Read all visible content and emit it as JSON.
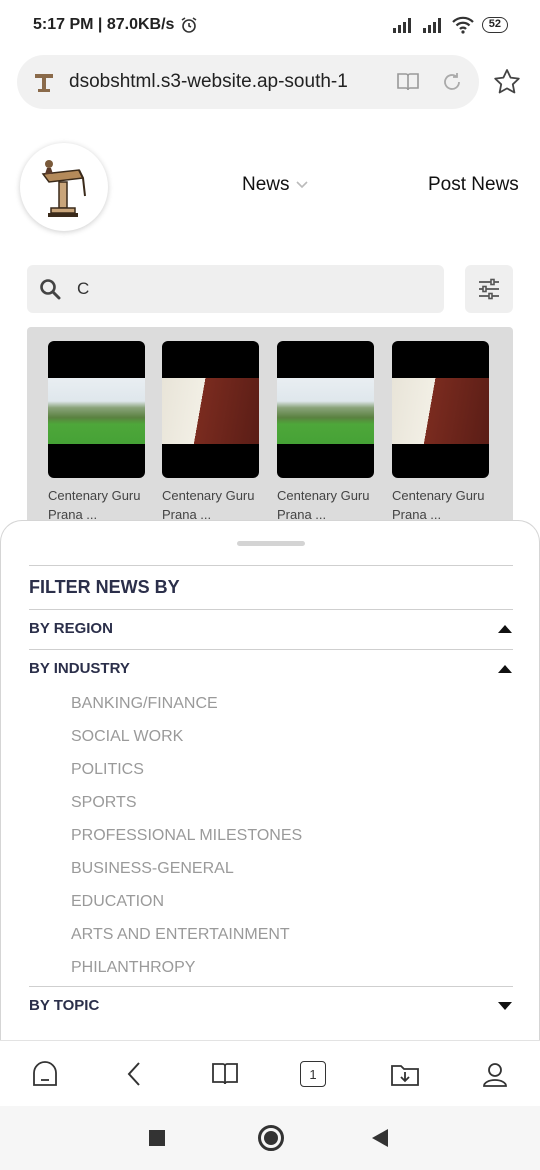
{
  "status_bar": {
    "time_speed": "5:17 PM | 87.0KB/s",
    "battery": "52"
  },
  "browser": {
    "url": "dsobshtml.s3-website.ap-south-1",
    "tab_count": "1"
  },
  "header": {
    "nav_news": "News",
    "nav_post": "Post News"
  },
  "search": {
    "value": "C"
  },
  "cards": [
    {
      "caption_line1": "Centenary Guru",
      "caption_line2": "Prana ..."
    },
    {
      "caption_line1": "Centenary Guru",
      "caption_line2": "Prana ..."
    },
    {
      "caption_line1": "Centenary Guru",
      "caption_line2": "Prana ..."
    },
    {
      "caption_line1": "Centenary Guru",
      "caption_line2": "Prana ..."
    }
  ],
  "filter": {
    "title": "FILTER NEWS BY",
    "region": "BY REGION",
    "industry": "BY INDUSTRY",
    "topic": "BY TOPIC",
    "industries": [
      "BANKING/FINANCE",
      "SOCIAL WORK",
      "POLITICS",
      "SPORTS",
      "PROFESSIONAL MILESTONES",
      "BUSINESS-GENERAL",
      "EDUCATION",
      "ARTS AND ENTERTAINMENT",
      "PHILANTHROPY"
    ]
  }
}
